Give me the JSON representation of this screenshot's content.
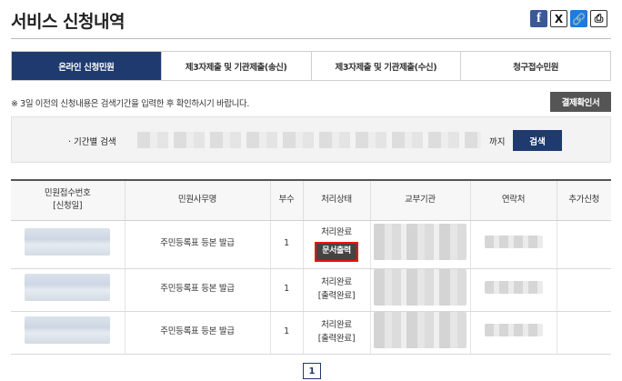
{
  "header": {
    "title": "서비스 신청내역"
  },
  "share": {
    "facebook": "f",
    "x": "X",
    "link": "🔗",
    "print": "⎙"
  },
  "tabs": [
    {
      "label": "온라인 신청민원",
      "active": true
    },
    {
      "label": "제3자제출 및 기관제출(송신)",
      "active": false
    },
    {
      "label": "제3자제출 및 기관제출(수신)",
      "active": false
    },
    {
      "label": "청구접수민원",
      "active": false
    }
  ],
  "notice": "※ 3일 이전의 신청내용은 검색기간을 입력한 후 확인하시기 바랍니다.",
  "payment_button": "결제확인서",
  "search": {
    "label": "· 기간별 검색",
    "until": "까지",
    "button": "검색"
  },
  "table": {
    "headers": [
      "민원접수번호\n[신청일]",
      "민원사무명",
      "부수",
      "처리상태",
      "교부기관",
      "연락처",
      "추가신청"
    ],
    "rows": [
      {
        "name": "주민등록표 등본 발급",
        "copies": "1",
        "status": "처리완료",
        "action": "문서출력"
      },
      {
        "name": "주민등록표 등본 발급",
        "copies": "1",
        "status": "처리완료",
        "action": "[출력완료]"
      },
      {
        "name": "주민등록표 등본 발급",
        "copies": "1",
        "status": "처리완료",
        "action": "[출력완료]"
      }
    ]
  },
  "pagination": {
    "current": "1"
  },
  "colors": {
    "navy": "#1e3a6e",
    "highlight": "#e11111"
  }
}
